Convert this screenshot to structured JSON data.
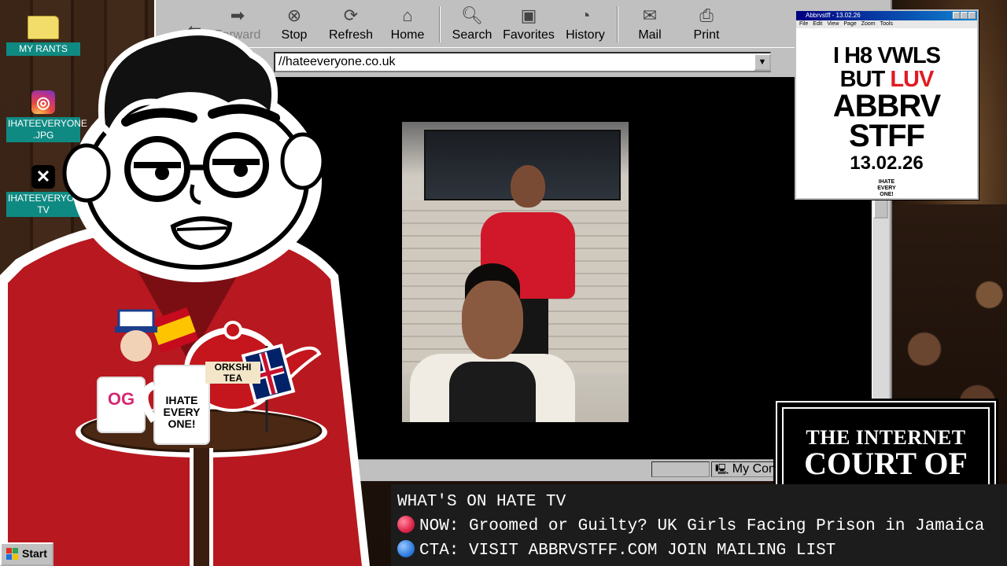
{
  "desktop_icons": [
    {
      "label": "MY RANTS",
      "icon": "folder-icon"
    },
    {
      "label": "IHATEEVERYONE\n.JPG",
      "icon": "instagram-icon"
    },
    {
      "label": "IHATEEVERYONE\nTV",
      "icon": "x-logo-icon"
    }
  ],
  "browser": {
    "toolbar": [
      "Forward",
      "Stop",
      "Refresh",
      "Home",
      "Search",
      "Favorites",
      "History",
      "Mail",
      "Print"
    ],
    "address": "//hateeveryone.co.uk",
    "status_right": "My Com"
  },
  "ad": {
    "title": "Abbrvstff - 13.02.26",
    "menu": [
      "File",
      "Edit",
      "View",
      "Page",
      "Zoom",
      "Tools"
    ],
    "line1": "I H8 VWLS",
    "line2a": "BUT ",
    "line2b": "LUV",
    "line3": "ABBRV",
    "line4": "STFF",
    "date": "13.02.26",
    "logo": "IHATE\nEVERY\nONE!"
  },
  "court": {
    "line1": "THE INTERNET",
    "line2": "COURT OF"
  },
  "ticker": {
    "heading": "WHAT'S ON HATE TV",
    "now": "NOW: Groomed or Guilty? UK Girls Facing Prison in Jamaica",
    "cta": "CTA: VISIT ABBRVSTFF.COM JOIN MAILING LIST"
  },
  "mug_text": "IHATE\nEVERY\nONE!",
  "teapot_text": "ORKSHI\nTEA",
  "taskbar": {
    "start": "Start"
  },
  "colors": {
    "accent_teal": "#0f8a83",
    "ticker_bg": "#1c1c1c",
    "ad_red": "#e11b22",
    "jacket_red": "#c4161c"
  }
}
